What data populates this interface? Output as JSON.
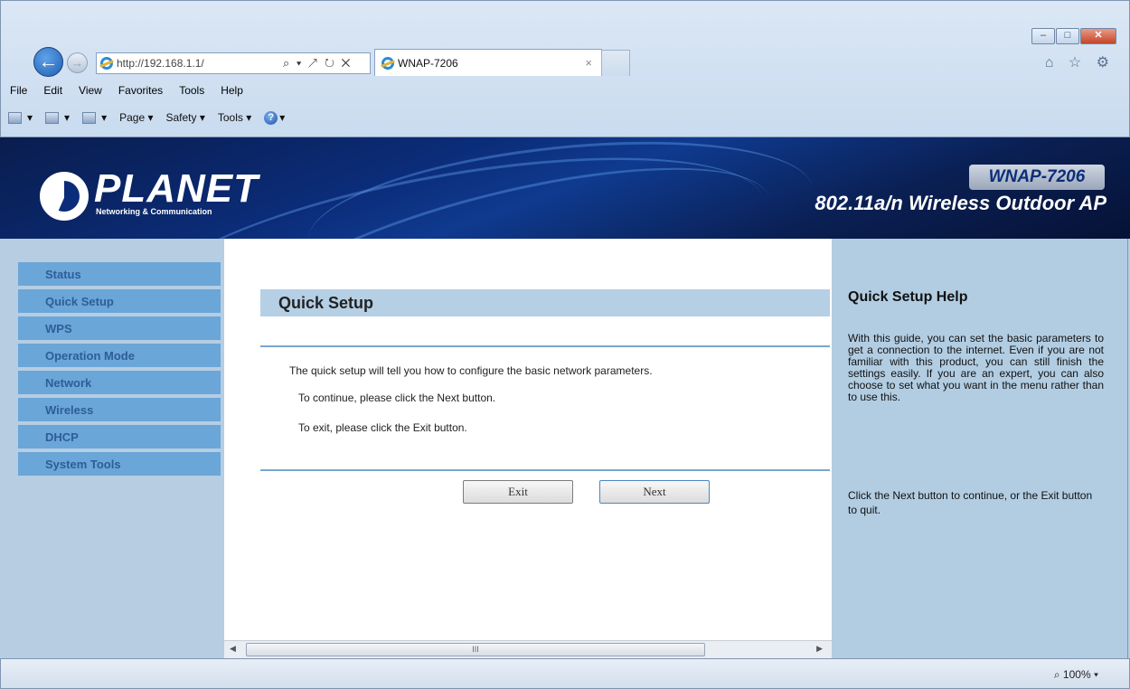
{
  "browser": {
    "address": "http://192.168.1.1/",
    "address_tools": "⌕ ▾ ↗ ↻ ✕",
    "tab_title": "WNAP-7206",
    "tab_close": "×",
    "window_buttons": [
      "–",
      "□",
      "✕"
    ],
    "menu": [
      "File",
      "Edit",
      "View",
      "Favorites",
      "Tools",
      "Help"
    ],
    "commands": [
      "▾",
      "▾",
      "▾",
      "Page ▾",
      "Safety ▾",
      "Tools ▾",
      "▾"
    ],
    "zoom": "⌕ 100%  ▾",
    "right_icons": "⌂ ☆ ⚙"
  },
  "banner": {
    "logo": "PLANET",
    "logo_subtitle": "Networking & Communication",
    "model": "WNAP-7206",
    "product": "802.11a/n Wireless Outdoor AP"
  },
  "sidebar": {
    "items": [
      "Status",
      "Quick Setup",
      "WPS",
      "Operation Mode",
      "Network",
      "Wireless",
      "DHCP",
      "System Tools"
    ]
  },
  "main": {
    "title": "Quick Setup",
    "line1": "The quick setup will tell you how to configure the basic network parameters.",
    "line2": "To continue, please click the Next button.",
    "line3": "To exit, please click the Exit  button.",
    "exit_label": "Exit",
    "next_label": "Next",
    "scroll_grip": "III"
  },
  "help": {
    "title": "Quick Setup Help",
    "p1": "With this guide, you can set the basic parameters to get a connection to the internet. Even if you are not familiar with this product, you can still finish the settings easily. If you are an expert, you can also choose to set what you want in the menu rather than to use this.",
    "p2": "Click the Next button to continue, or the Exit button to quit."
  }
}
